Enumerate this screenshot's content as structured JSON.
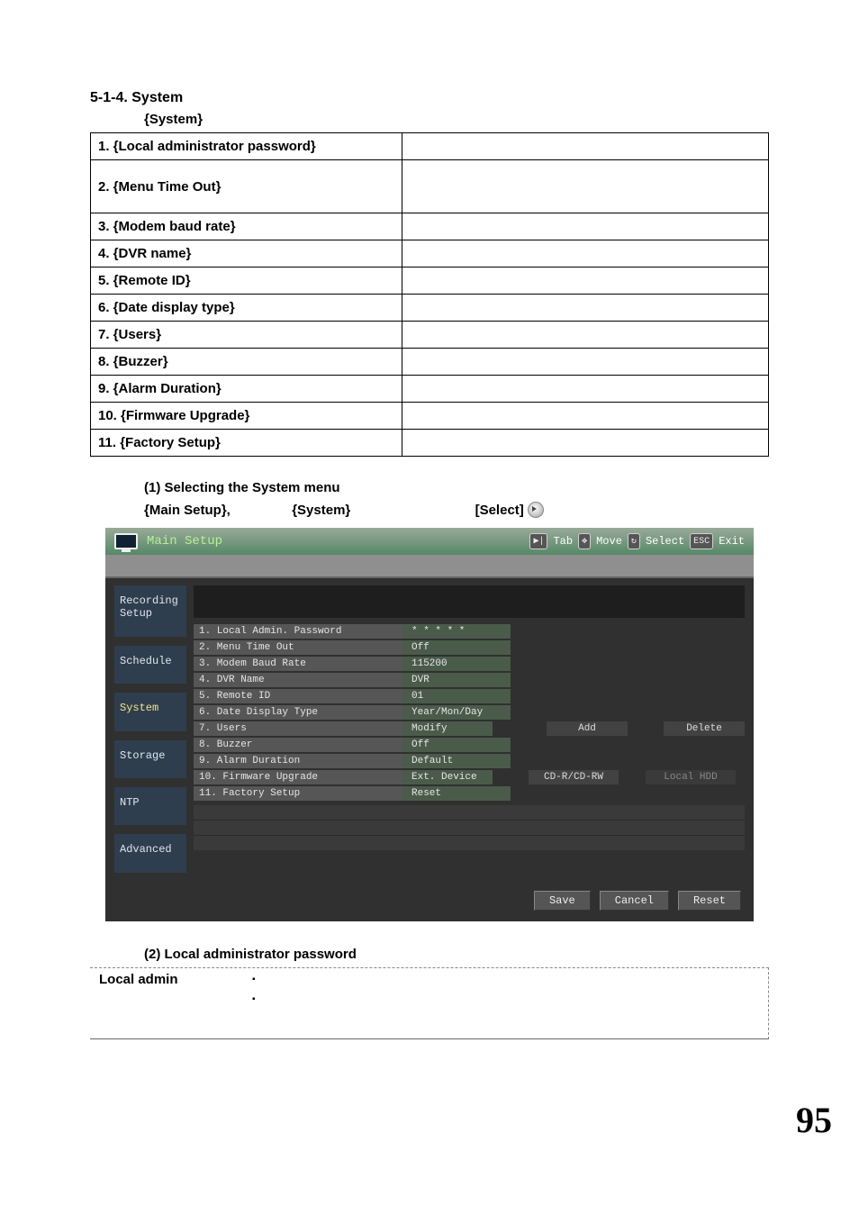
{
  "section_title": "5-1-4. System",
  "system_heading": "{System}",
  "rows": [
    "1. {Local administrator password}",
    "2. {Menu Time Out}",
    "3. {Modem baud rate}",
    "4. {DVR name}",
    "5. {Remote ID}",
    "6. {Date display type}",
    "7. {Users}",
    "8. {Buzzer}",
    "9. {Alarm Duration}",
    "10. {Firmware Upgrade}",
    "11. {Factory Setup}"
  ],
  "subsection1": "(1) Selecting the System menu",
  "bc_main": "{Main Setup},",
  "bc_system": "{System}",
  "bc_select": "[Select]",
  "dvr_title": "Main Setup",
  "hints": {
    "tab": "Tab",
    "move": "Move",
    "select": "Select",
    "exit": "Exit"
  },
  "side_tabs": [
    "Recording Setup",
    "Schedule",
    "System",
    "Storage",
    "NTP",
    "Advanced"
  ],
  "menu": {
    "r1": {
      "label": "1. Local Admin. Password",
      "v": "* * * * *"
    },
    "r2": {
      "label": "2. Menu Time Out",
      "v": "Off"
    },
    "r3": {
      "label": "3. Modem Baud Rate",
      "v": "115200"
    },
    "r4": {
      "label": "4. DVR Name",
      "v": "DVR"
    },
    "r5": {
      "label": "5. Remote ID",
      "v": "01"
    },
    "r6": {
      "label": "6. Date Display Type",
      "v": "Year/Mon/Day"
    },
    "r7": {
      "label": "7. Users",
      "v1": "Modify",
      "v2": "Add",
      "v3": "Delete"
    },
    "r8": {
      "label": "8. Buzzer",
      "v": "Off"
    },
    "r9": {
      "label": "9. Alarm Duration",
      "v": "Default"
    },
    "r10": {
      "label": "10. Firmware Upgrade",
      "v1": "Ext. Device",
      "v2": "CD-R/CD-RW",
      "v3": "Local HDD"
    },
    "r11": {
      "label": "11. Factory Setup",
      "v": "Reset"
    }
  },
  "buttons": {
    "save": "Save",
    "cancel": "Cancel",
    "reset": "Reset"
  },
  "subsection2": "(2) Local administrator password",
  "local_admin_label": "Local admin",
  "page_number": "95"
}
